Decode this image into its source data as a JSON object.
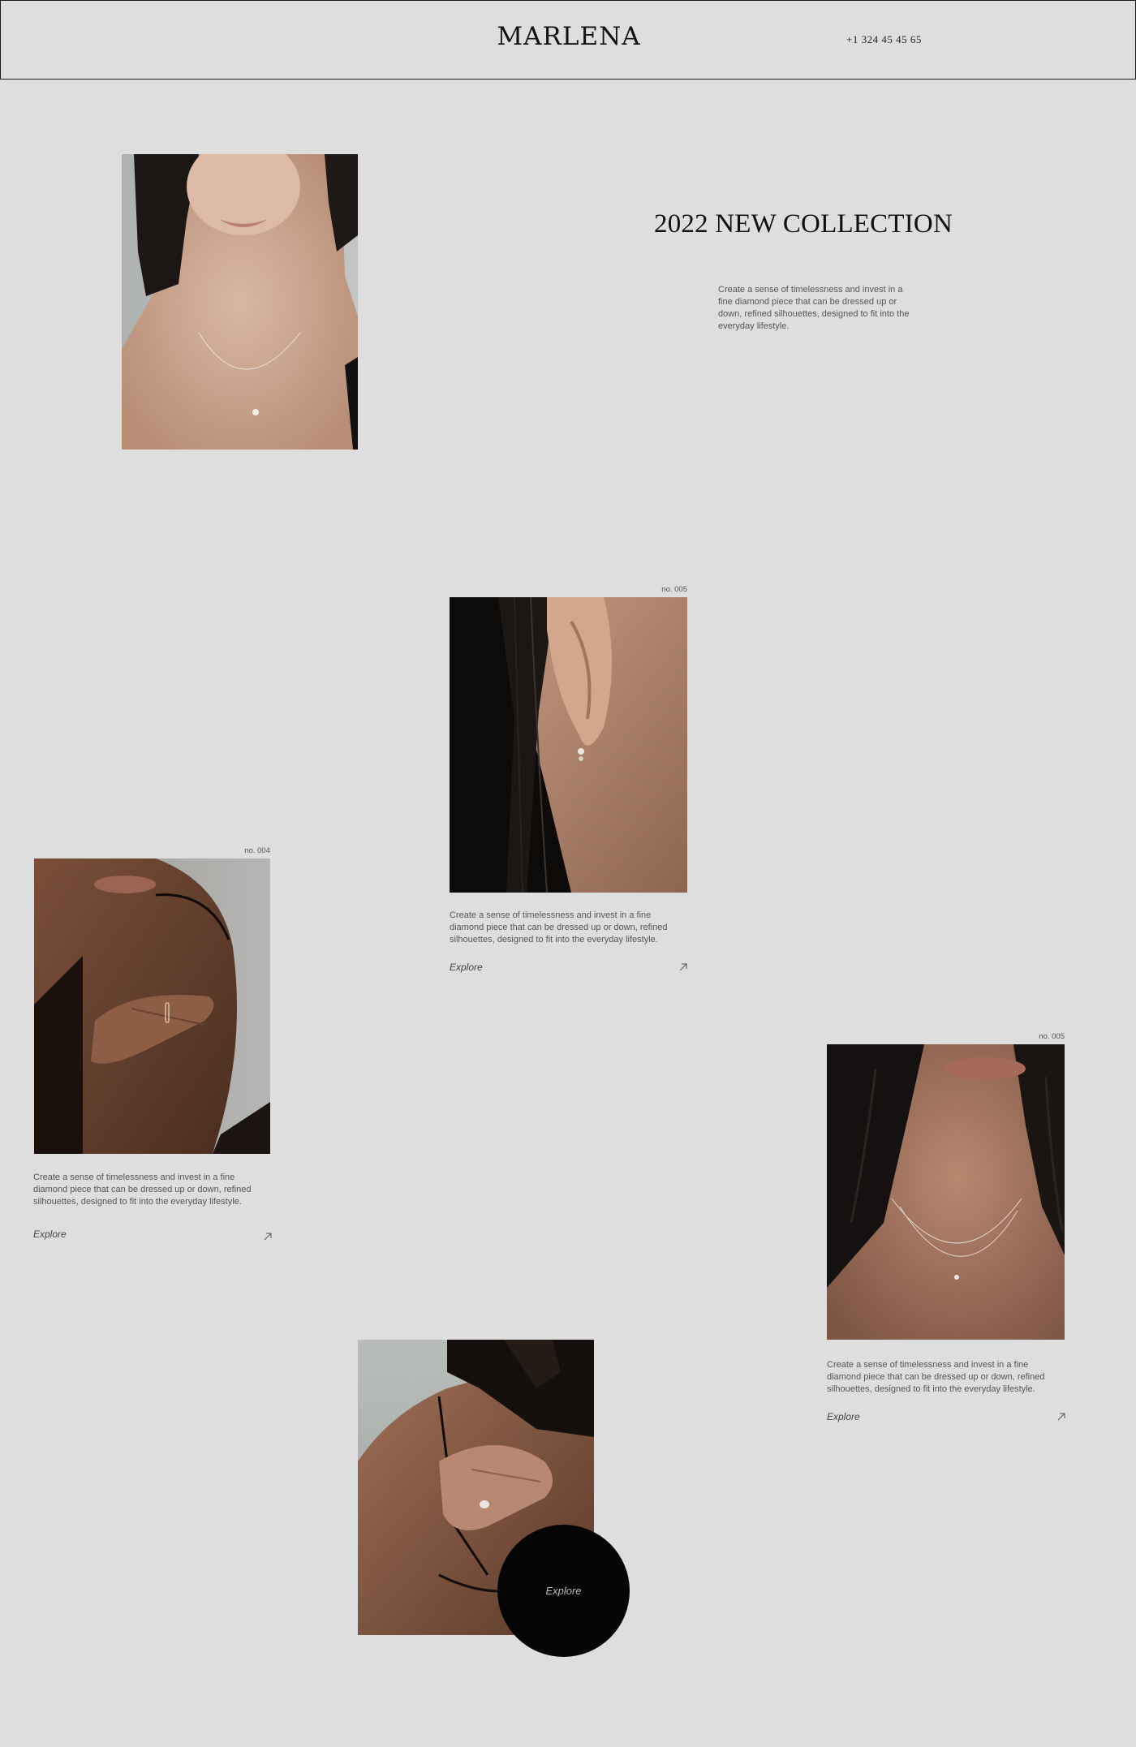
{
  "header": {
    "brand": "MARLENA",
    "phone": "+1 324 45 45 65"
  },
  "hero": {
    "title": "2022 NEW COLLECTION",
    "description": "Create a sense of timelessness and invest in a fine diamond piece that can be dressed up or down, refined silhouettes, designed to fit into the everyday lifestyle."
  },
  "products": [
    {
      "number": "no. 005",
      "description": "Create a sense of timelessness and invest in a fine diamond piece that can be dressed up or down, refined silhouettes, designed to fit into the everyday lifestyle.",
      "explore_label": "Explore",
      "image": "earring-photo"
    },
    {
      "number": "no. 004",
      "description": "Create a sense of timelessness and invest in a fine diamond piece that can be dressed up or down, refined silhouettes, designed to fit into the everyday lifestyle.",
      "explore_label": "Explore",
      "image": "ring-photo"
    },
    {
      "number": "no. 005",
      "description": "Create a sense of timelessness and invest in a fine diamond piece that can be dressed up or down, refined silhouettes, designed to fit into the everyday lifestyle.",
      "explore_label": "Explore",
      "image": "layered-necklace-photo"
    }
  ],
  "feature": {
    "explore_label": "Explore",
    "image": "shoulder-ring-photo"
  },
  "icons": {
    "arrow": "arrow-up-right-icon"
  },
  "colors": {
    "background": "#dedede",
    "text": "#111111",
    "circle": "#050505"
  }
}
